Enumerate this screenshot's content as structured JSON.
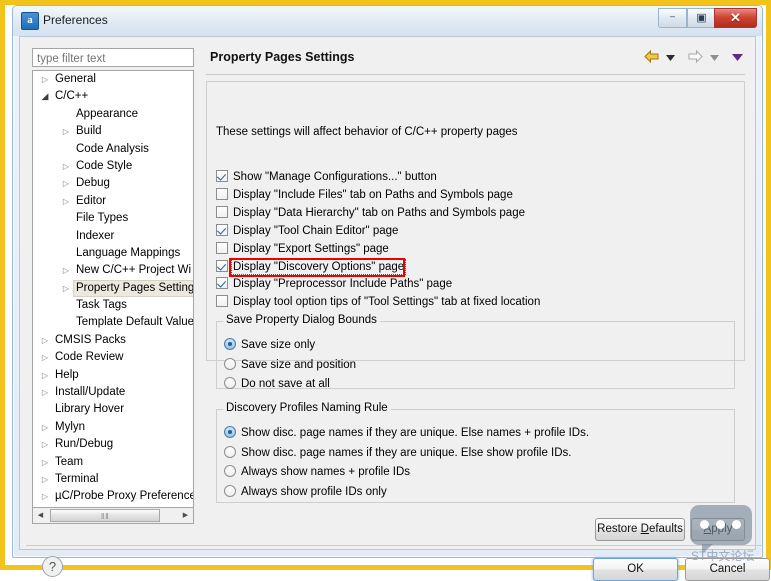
{
  "window": {
    "title": "Preferences",
    "icon": "a",
    "controls": {
      "minimize": "–",
      "maximize": "▣",
      "close": "✕"
    }
  },
  "sidebar": {
    "filter_placeholder": "type filter text",
    "filter_value": "",
    "items": [
      {
        "label": "General",
        "indent": 0,
        "twisty": "collapsed",
        "selected": false
      },
      {
        "label": "C/C++",
        "indent": 0,
        "twisty": "expanded",
        "selected": false
      },
      {
        "label": "Appearance",
        "indent": 1,
        "twisty": "none",
        "selected": false
      },
      {
        "label": "Build",
        "indent": 1,
        "twisty": "collapsed",
        "selected": false
      },
      {
        "label": "Code Analysis",
        "indent": 1,
        "twisty": "none",
        "selected": false
      },
      {
        "label": "Code Style",
        "indent": 1,
        "twisty": "collapsed",
        "selected": false
      },
      {
        "label": "Debug",
        "indent": 1,
        "twisty": "collapsed",
        "selected": false
      },
      {
        "label": "Editor",
        "indent": 1,
        "twisty": "collapsed",
        "selected": false
      },
      {
        "label": "File Types",
        "indent": 1,
        "twisty": "none",
        "selected": false
      },
      {
        "label": "Indexer",
        "indent": 1,
        "twisty": "none",
        "selected": false
      },
      {
        "label": "Language Mappings",
        "indent": 1,
        "twisty": "none",
        "selected": false
      },
      {
        "label": "New C/C++ Project Wi",
        "indent": 1,
        "twisty": "collapsed",
        "selected": false
      },
      {
        "label": "Property Pages Settings",
        "indent": 1,
        "twisty": "collapsed",
        "selected": true
      },
      {
        "label": "Task Tags",
        "indent": 1,
        "twisty": "none",
        "selected": false
      },
      {
        "label": "Template Default Value",
        "indent": 1,
        "twisty": "none",
        "selected": false
      },
      {
        "label": "CMSIS Packs",
        "indent": 0,
        "twisty": "collapsed",
        "selected": false
      },
      {
        "label": "Code Review",
        "indent": 0,
        "twisty": "collapsed",
        "selected": false
      },
      {
        "label": "Help",
        "indent": 0,
        "twisty": "collapsed",
        "selected": false
      },
      {
        "label": "Install/Update",
        "indent": 0,
        "twisty": "collapsed",
        "selected": false
      },
      {
        "label": "Library Hover",
        "indent": 0,
        "twisty": "none",
        "selected": false
      },
      {
        "label": "Mylyn",
        "indent": 0,
        "twisty": "collapsed",
        "selected": false
      },
      {
        "label": "Run/Debug",
        "indent": 0,
        "twisty": "collapsed",
        "selected": false
      },
      {
        "label": "Team",
        "indent": 0,
        "twisty": "collapsed",
        "selected": false
      },
      {
        "label": "Terminal",
        "indent": 0,
        "twisty": "collapsed",
        "selected": false
      },
      {
        "label": "µC/Probe Proxy Preference",
        "indent": 0,
        "twisty": "collapsed",
        "selected": false
      }
    ],
    "scrollbar": {
      "left_arrow": "◀",
      "right_arrow": "▶",
      "grip": "‖‖"
    }
  },
  "content": {
    "page_title": "Property Pages Settings",
    "description": "These settings will affect behavior of C/C++ property pages",
    "nav": {
      "back": "back-arrow",
      "back_menu": "▾",
      "forward": "forward-arrow",
      "forward_menu": "▾",
      "view_menu": "▾"
    },
    "checkboxes": [
      {
        "label": "Show \"Manage Configurations...\" button",
        "checked": true,
        "focused": false
      },
      {
        "label": "Display \"Include Files\" tab on Paths and Symbols page",
        "checked": false,
        "focused": false
      },
      {
        "label": "Display \"Data Hierarchy\" tab on Paths and Symbols page",
        "checked": false,
        "focused": false
      },
      {
        "label": "Display \"Tool Chain Editor\" page",
        "checked": true,
        "focused": false
      },
      {
        "label": "Display \"Export Settings\" page",
        "checked": false,
        "focused": false
      },
      {
        "label": "Display \"Discovery Options\" page",
        "checked": true,
        "focused": true
      },
      {
        "label": "Display \"Preprocessor Include Paths\" page",
        "checked": true,
        "focused": false
      },
      {
        "label": "Display tool option tips of \"Tool Settings\" tab at fixed location",
        "checked": false,
        "focused": false
      }
    ],
    "group_save_bounds": {
      "title": "Save Property Dialog Bounds",
      "options": [
        {
          "label": "Save size only",
          "selected": true
        },
        {
          "label": "Save size and position",
          "selected": false
        },
        {
          "label": "Do not save at all",
          "selected": false
        }
      ]
    },
    "group_naming_rule": {
      "title": "Discovery Profiles Naming Rule",
      "options": [
        {
          "label": "Show disc. page names if they are unique. Else names + profile IDs.",
          "selected": true
        },
        {
          "label": "Show disc. page names if they are unique. Else show profile IDs.",
          "selected": false
        },
        {
          "label": "Always show names + profile IDs",
          "selected": false
        },
        {
          "label": "Always show profile IDs only",
          "selected": false
        }
      ]
    }
  },
  "buttons": {
    "restore_defaults_pre": "Restore ",
    "restore_defaults_key": "D",
    "restore_defaults_post": "efaults",
    "apply_key": "A",
    "apply_post": "pply",
    "ok": "OK",
    "cancel": "Cancel",
    "help": "?"
  },
  "watermark": {
    "text": "ST中文论坛"
  },
  "colors": {
    "frame": "#f2c41b",
    "annotation": "#ee0000",
    "accent": "#1b5f9e",
    "close_button": "#cf4534"
  }
}
